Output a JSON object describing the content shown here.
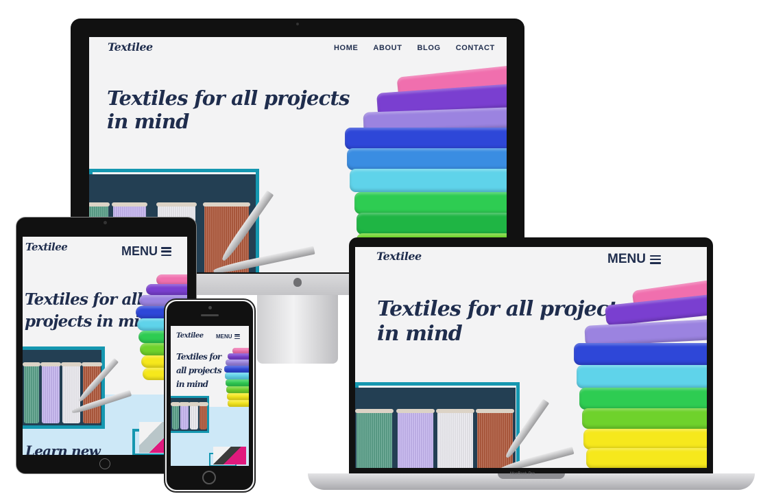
{
  "site": {
    "logo": "Textilee",
    "nav": [
      "HOME",
      "ABOUT",
      "BLOG",
      "CONTACT"
    ],
    "menu_label": "MENU",
    "hero_line1": "Textiles for all projects",
    "hero_line2": "in mind",
    "hero_tablet_line1": "Textiles for all",
    "hero_tablet_line2": "projects in mind",
    "hero_phone_line1": "Textiles for",
    "hero_phone_line2": "all projects",
    "hero_phone_line3": "in mind",
    "learn_text": "Learn new"
  },
  "laptop": {
    "model_label": "MacBook Pro"
  },
  "colors": {
    "brand_navy": "#1f2d4d",
    "background": "#f3f3f4",
    "teal_border": "#1597b0",
    "dark_panel": "#233f53",
    "fabrics": [
      "#f06fae",
      "#7a3fd0",
      "#9b83e0",
      "#2e47d8",
      "#3a8de2",
      "#5fd3ea",
      "#2ecc52",
      "#1fb544",
      "#6fd22c",
      "#f6e81c"
    ]
  },
  "icons": [
    "apple-icon",
    "hamburger-icon",
    "camera-icon",
    "home-button-icon"
  ]
}
